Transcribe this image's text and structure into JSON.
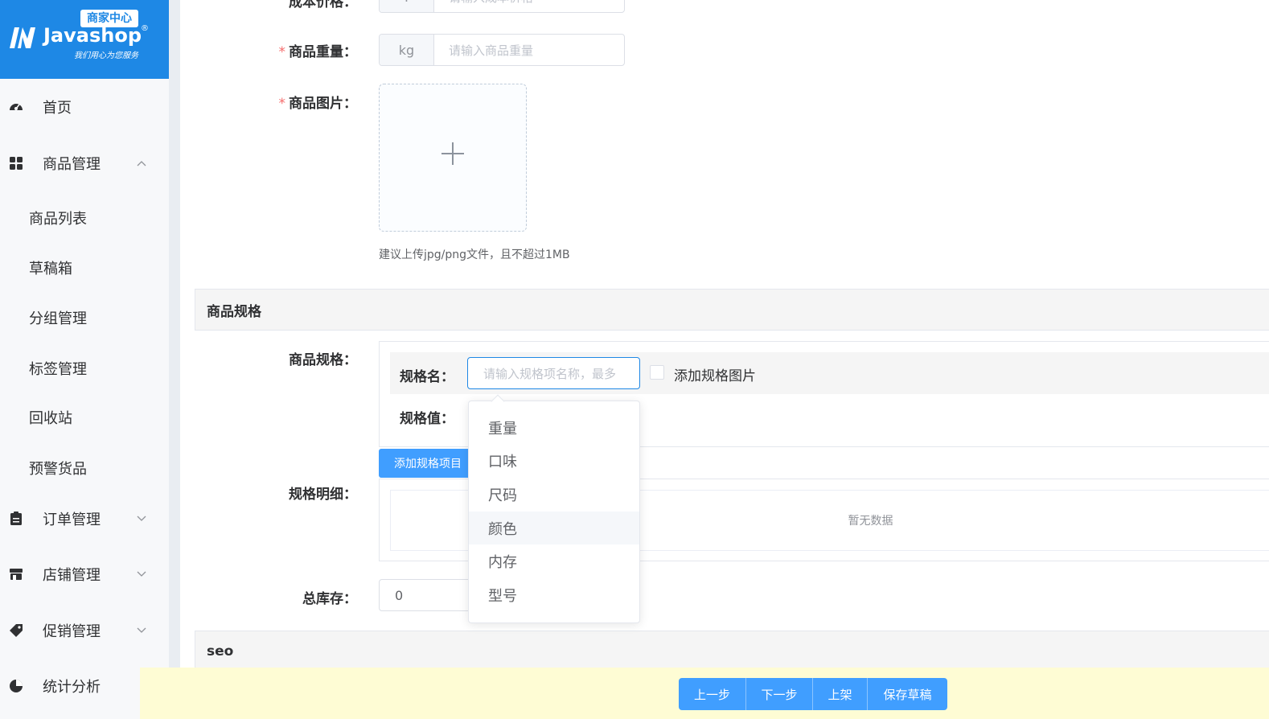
{
  "logo": {
    "badge": "商家中心",
    "brand": "Javashop",
    "registered": "®",
    "slogan": "我们用心为您服务"
  },
  "sidebar": {
    "items": [
      {
        "label": "首页",
        "icon": "dashboard-icon"
      },
      {
        "label": "商品管理",
        "icon": "grid-icon",
        "expanded": true
      },
      {
        "label": "订单管理",
        "icon": "clipboard-icon"
      },
      {
        "label": "店铺管理",
        "icon": "store-icon"
      },
      {
        "label": "促销管理",
        "icon": "tag-icon"
      },
      {
        "label": "统计分析",
        "icon": "pie-chart-icon"
      }
    ],
    "subitems": [
      "商品列表",
      "草稿箱",
      "分组管理",
      "标签管理",
      "回收站",
      "预警货品"
    ]
  },
  "form": {
    "cost_price_label": "成本价格：",
    "cost_price_prefix": "¥",
    "cost_price_placeholder": "请输入成本价格",
    "weight_label": "商品重量：",
    "weight_prefix": "kg",
    "weight_placeholder": "请输入商品重量",
    "image_label": "商品图片：",
    "image_hint": "建议上传jpg/png文件，且不超过1MB"
  },
  "spec_section": {
    "title": "商品规格",
    "spec_label": "商品规格：",
    "spec_name_label": "规格名：",
    "spec_name_placeholder": "请输入规格项名称，最多",
    "add_image_checkbox": "添加规格图片",
    "spec_value_label": "规格值：",
    "add_spec_button": "添加规格项目",
    "detail_label": "规格明细：",
    "empty_text": "暂无数据",
    "stock_label": "总库存：",
    "stock_value": "0"
  },
  "dropdown": {
    "options": [
      "重量",
      "口味",
      "尺码",
      "颜色",
      "内存",
      "型号"
    ],
    "hovered": "颜色"
  },
  "seo_section": {
    "title": "seo"
  },
  "footer": {
    "prev": "上一步",
    "next": "下一步",
    "publish": "上架",
    "save_draft": "保存草稿"
  },
  "colors": {
    "brand": "#1e88e5",
    "primary_button": "#409eff",
    "footer_bg": "#fefcd4",
    "required": "#f56c6c"
  }
}
